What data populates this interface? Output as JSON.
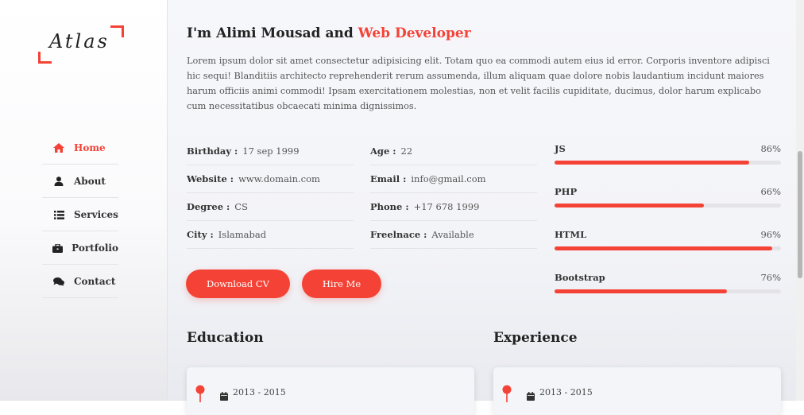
{
  "logo": {
    "text": "Atlas"
  },
  "nav": [
    {
      "label": "Home",
      "icon": "home-icon",
      "active": true
    },
    {
      "label": "About",
      "icon": "user-icon",
      "active": false
    },
    {
      "label": "Services",
      "icon": "list-icon",
      "active": false
    },
    {
      "label": "Portfolio",
      "icon": "briefcase-icon",
      "active": false
    },
    {
      "label": "Contact",
      "icon": "comments-icon",
      "active": false
    }
  ],
  "hero": {
    "title_prefix": "I'm Alimi Mousad and ",
    "title_accent": "Web Developer",
    "intro": "Lorem ipsum dolor sit amet consectetur adipisicing elit. Totam quo ea commodi autem eius id error. Corporis inventore adipisci hic sequi! Blanditiis architecto reprehenderit rerum assumenda, illum aliquam quae dolore nobis laudantium incidunt maiores harum officiis animi commodi! Ipsam exercitationem molestias, non et velit facilis cupiditate, ducimus, dolor harum explicabo cum necessitatibus obcaecati minima dignissimos."
  },
  "info": {
    "col1": [
      {
        "key": "Birthday :",
        "value": "17 sep 1999"
      },
      {
        "key": "Website :",
        "value": "www.domain.com"
      },
      {
        "key": "Degree :",
        "value": "CS"
      },
      {
        "key": "City :",
        "value": "Islamabad"
      }
    ],
    "col2": [
      {
        "key": "Age :",
        "value": "22"
      },
      {
        "key": "Email :",
        "value": "info@gmail.com"
      },
      {
        "key": "Phone :",
        "value": "+17 678 1999"
      },
      {
        "key": "Freelnace :",
        "value": "Available"
      }
    ]
  },
  "skills": [
    {
      "name": "JS",
      "percent_label": "86%",
      "value": 86
    },
    {
      "name": "PHP",
      "percent_label": "66%",
      "value": 66
    },
    {
      "name": "HTML",
      "percent_label": "96%",
      "value": 96
    },
    {
      "name": "Bootstrap",
      "percent_label": "76%",
      "value": 76
    }
  ],
  "buttons": {
    "download": "Download CV",
    "hire": "Hire Me"
  },
  "sections": {
    "education": {
      "title": "Education",
      "date": "2013 - 2015"
    },
    "experience": {
      "title": "Experience",
      "date": "2013 - 2015"
    }
  },
  "colors": {
    "accent": "#f44336"
  }
}
